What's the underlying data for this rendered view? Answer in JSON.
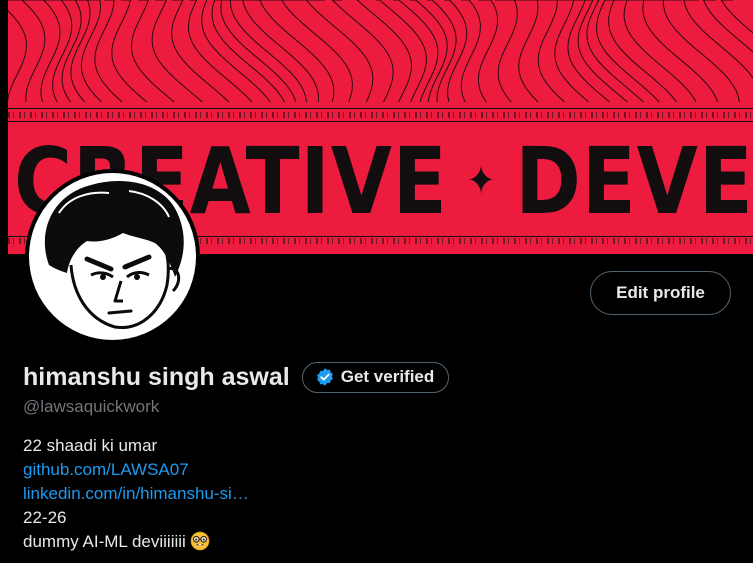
{
  "banner": {
    "headline_left": "CREATIVE",
    "headline_sep": "✦",
    "headline_right": "DEVELOPER",
    "color": "#ed1c3f"
  },
  "profile": {
    "display_name": "himanshu singh aswal",
    "verify_label": "Get verified",
    "handle": "@lawsaquickwork",
    "edit_label": "Edit profile"
  },
  "bio": {
    "line1": "22 shaadi ki umar",
    "link1": "github.com/LAWSA07",
    "link2": "linkedin.com/in/himanshu-si…",
    "line4": "22-26",
    "line5": "dummy AI-ML deviiiiiii",
    "emoji_icon": "nerd-face-icon"
  },
  "colors": {
    "link": "#1d9bf0",
    "verified_badge": "#1d9bf0",
    "muted": "#71767b"
  }
}
